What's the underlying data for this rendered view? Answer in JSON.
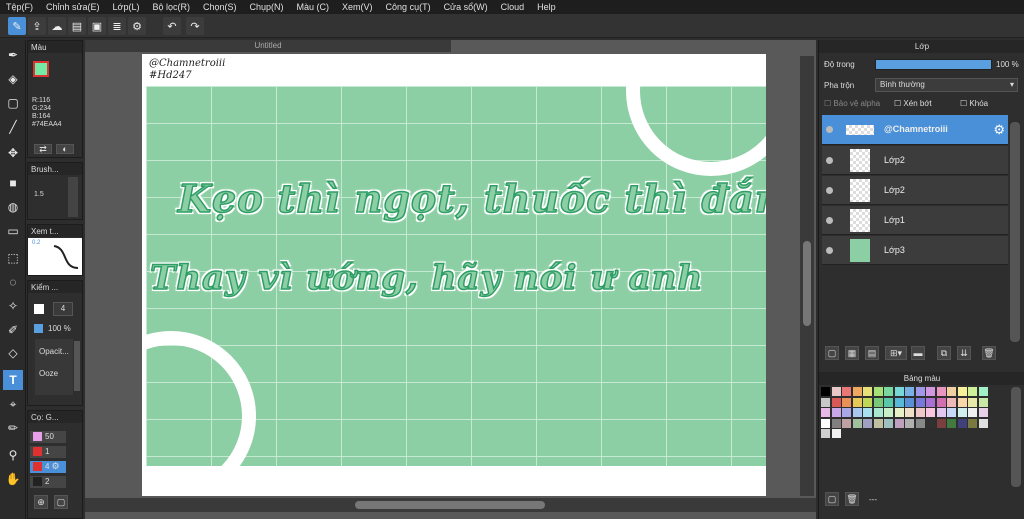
{
  "menu": [
    "Tệp(F)",
    "Chỉnh sửa(E)",
    "Lớp(L)",
    "Bộ lọc(R)",
    "Chọn(S)",
    "Chụp(N)",
    "Màu (C)",
    "Xem(V)",
    "Công cụ(T)",
    "Cửa sổ(W)",
    "Cloud",
    "Help"
  ],
  "doc_tab": "Untitled",
  "color_panel": {
    "title": "Màu",
    "r": "R:116",
    "g": "G:234",
    "b": "B:164",
    "hex": "#74EAA4",
    "fg": "#74EAA4",
    "bg": "#ffffff"
  },
  "brush_panel": {
    "title": "Brush...",
    "size": "1.5"
  },
  "preview_panel": {
    "title": "Xem t...",
    "val": "0.2"
  },
  "check_panel": {
    "title": "Kiểm ...",
    "num": "4",
    "pct": "100 %",
    "opacity": "Opacit...",
    "ooze": "Ooze"
  },
  "brushlist_panel": {
    "title": "Cọ: G...",
    "items": [
      "50",
      "1",
      "4",
      "2"
    ]
  },
  "canvas": {
    "watermark1": "@Chamnetroiii",
    "watermark2": "#Hd247",
    "line1": "Kẹo thì ngọt, thuốc thì đắng",
    "line2": "Thay vì ướng, hãy nói ư anh"
  },
  "layer_panel": {
    "title": "Lớp",
    "opacity_label": "Độ trong",
    "opacity_value": "100 %",
    "blend_label": "Pha trộn",
    "blend_value": "Bình thường",
    "protect_alpha": "Bảo vệ alpha",
    "clip": "Xén bớt",
    "lock": "Khóa",
    "layers": [
      {
        "name": "@Chamnetroiii"
      },
      {
        "name": "Lớp2"
      },
      {
        "name": "Lớp2"
      },
      {
        "name": "Lớp1"
      },
      {
        "name": "Lớp3"
      }
    ]
  },
  "palette_panel": {
    "title": "Bảng màu",
    "footer": "---",
    "colors": [
      "#000000",
      "#e8c8c8",
      "#e87878",
      "#f0a860",
      "#e8e078",
      "#a8e078",
      "#78d8a0",
      "#78d8d8",
      "#78b0e8",
      "#a098e8",
      "#d098e0",
      "#e898c0",
      "#f0d0a0",
      "#f8f098",
      "#d0f098",
      "#a0f0c8",
      "#c8c8c8",
      "#d85858",
      "#e89058",
      "#e8c858",
      "#c0d858",
      "#78c878",
      "#58c8a8",
      "#58b8d8",
      "#5890d8",
      "#7878d8",
      "#a870d0",
      "#d070b0",
      "#f0b8b8",
      "#f8d8a8",
      "#e8e8a8",
      "#c8e8a8",
      "#e8b8e8",
      "#c8a8e8",
      "#a8a8e8",
      "#a8c8f0",
      "#a8e0f0",
      "#a8e8d0",
      "#c8f0c8",
      "#e8f0c8",
      "#f0e0c8",
      "#f0c8c8",
      "#f8c8e0",
      "#e0c8f0",
      "#c8d8f8",
      "#d0f0f0",
      "#f0f0f0",
      "#e8d0e8",
      "#ffffff",
      "#808080",
      "#c0a0a0",
      "#a0c0a0",
      "#a0a0c0",
      "#c0c0a0",
      "#a0c0c0",
      "#c0a0c0",
      "#b0b0b0",
      "#888888",
      "#303030",
      "#7a4040",
      "#407a40",
      "#40407a",
      "#7a7a40",
      "#e0e0e0",
      "#d0d0d0",
      "#f0f0f0"
    ]
  }
}
